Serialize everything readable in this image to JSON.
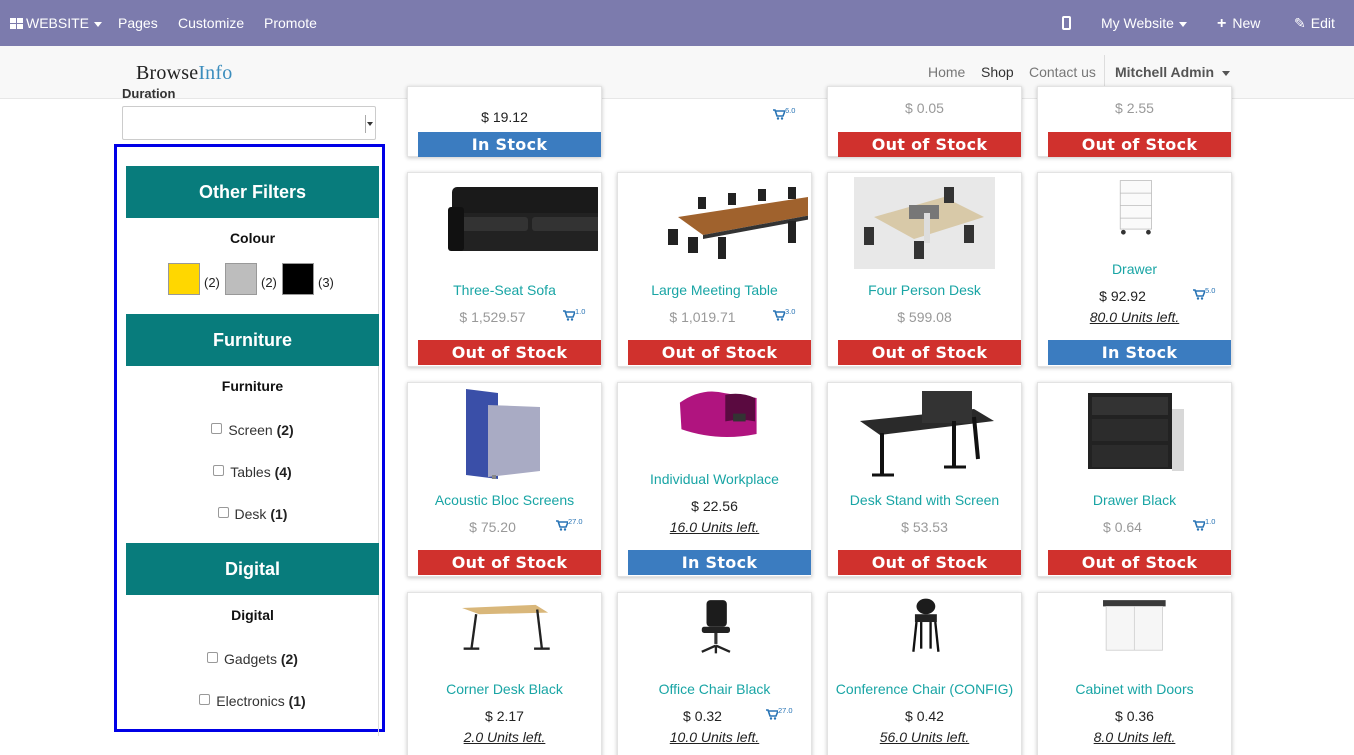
{
  "admin_bar": {
    "website_label": "WEBSITE",
    "pages_label": "Pages",
    "customize_label": "Customize",
    "promote_label": "Promote",
    "site_switch_label": "My Website",
    "new_label": "New",
    "edit_label": "Edit",
    "bar_color": "#7c7bad"
  },
  "navbar": {
    "logo_part1": "Browse",
    "logo_part2": "Info",
    "links": [
      "Home",
      "Shop",
      "Contact us"
    ],
    "user_label": "Mitchell Admin"
  },
  "sidebar": {
    "duration_label": "Duration",
    "filter_border_color": "#0000e6",
    "other_filters": {
      "title": "Other Filters",
      "colour_title": "Colour",
      "swatches": [
        {
          "color": "#ffd700",
          "count": "(2)"
        },
        {
          "color": "#bdbdbd",
          "count": "(2)"
        },
        {
          "color": "#000000",
          "count": "(3)"
        }
      ]
    },
    "furniture": {
      "title": "Furniture",
      "sub_title": "Furniture",
      "items": [
        {
          "label": "Screen",
          "count": "(2)"
        },
        {
          "label": "Tables",
          "count": "(4)"
        },
        {
          "label": "Desk",
          "count": "(1)"
        }
      ]
    },
    "digital": {
      "title": "Digital",
      "sub_title": "Digital",
      "items": [
        {
          "label": "Gadgets",
          "count": "(2)"
        },
        {
          "label": "Electronics",
          "count": "(1)"
        }
      ]
    }
  },
  "products": {
    "top_row": [
      {
        "price": "$ 19.12",
        "cart": "6.0",
        "stock": "In Stock"
      },
      {
        "price": "$ 0.05",
        "stock": "Out of Stock"
      },
      {
        "price": "$ 2.55",
        "stock": "Out of Stock"
      }
    ],
    "row2": [
      {
        "name": "Three-Seat Sofa",
        "price": "$ 1,529.57",
        "cart": "1.0",
        "stock": "Out of Stock"
      },
      {
        "name": "Large Meeting Table",
        "price": "$ 1,019.71",
        "cart": "3.0",
        "stock": "Out of Stock"
      },
      {
        "name": "Four Person Desk",
        "price": "$ 599.08",
        "stock": "Out of Stock"
      },
      {
        "name": "Drawer",
        "price": "$ 92.92",
        "cart": "5.0",
        "units": "80.0 Units left.",
        "stock": "In Stock"
      }
    ],
    "row3": [
      {
        "name": "Acoustic Bloc Screens",
        "price": "$ 75.20",
        "cart": "27.0",
        "stock": "Out of Stock"
      },
      {
        "name": "Individual Workplace",
        "price": "$ 22.56",
        "units": "16.0 Units left.",
        "stock": "In Stock"
      },
      {
        "name": "Desk Stand with Screen",
        "price": "$ 53.53",
        "stock": "Out of Stock"
      },
      {
        "name": "Drawer Black",
        "price": "$ 0.64",
        "cart": "1.0",
        "stock": "Out of Stock"
      }
    ],
    "row4": [
      {
        "name": "Corner Desk Black",
        "price": "$ 2.17",
        "units": "2.0 Units left."
      },
      {
        "name": "Office Chair Black",
        "price": "$ 0.32",
        "cart": "27.0",
        "units": "10.0 Units left."
      },
      {
        "name": "Conference Chair (CONFIG)",
        "price": "$ 0.42",
        "units": "56.0 Units left."
      },
      {
        "name": "Cabinet with Doors",
        "price": "$ 0.36",
        "units": "8.0 Units left."
      }
    ],
    "colors": {
      "name": "#19a5a5",
      "out_of_stock": "#d0312d",
      "in_stock": "#3b7cc0",
      "filter_header": "#087c7c"
    }
  }
}
